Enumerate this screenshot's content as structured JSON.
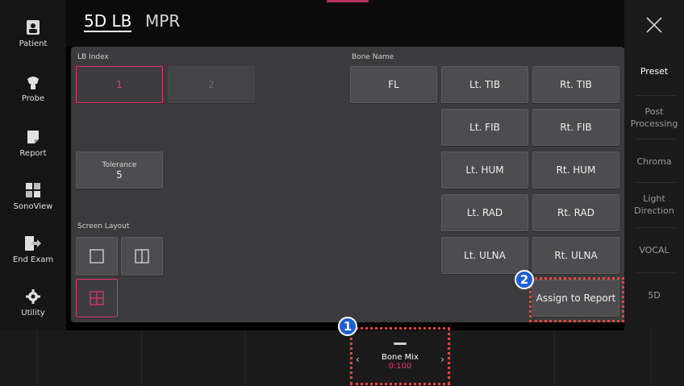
{
  "sidebar": {
    "items": [
      {
        "label": "Patient",
        "icon": "patient-icon"
      },
      {
        "label": "Probe",
        "icon": "probe-icon"
      },
      {
        "label": "Report",
        "icon": "report-icon"
      },
      {
        "label": "SonoView",
        "icon": "sonoview-icon"
      },
      {
        "label": "End Exam",
        "icon": "end-exam-icon"
      },
      {
        "label": "Utility",
        "icon": "gear-icon"
      }
    ]
  },
  "header": {
    "tabs": [
      {
        "label": "5D LB",
        "active": true
      },
      {
        "label": "MPR",
        "active": false
      }
    ]
  },
  "right_menu": {
    "items": [
      {
        "label": "Preset",
        "active": true
      },
      {
        "label": "Post Processing",
        "active": false
      },
      {
        "label": "Chroma",
        "active": false
      },
      {
        "label": "Light Direction",
        "active": false
      },
      {
        "label": "VOCAL",
        "active": false
      },
      {
        "label": "5D",
        "active": false
      }
    ]
  },
  "panel": {
    "lb_index_label": "LB Index",
    "lb_index_buttons": [
      "1",
      "2"
    ],
    "tolerance_label": "Tolerance",
    "tolerance_value": "5",
    "screen_layout_label": "Screen Layout",
    "bone_name_label": "Bone Name",
    "bone_buttons": {
      "fl": "FL",
      "lt_tib": "Lt. TIB",
      "rt_tib": "Rt. TIB",
      "lt_fib": "Lt. FIB",
      "rt_fib": "Rt. FIB",
      "lt_hum": "Lt. HUM",
      "rt_hum": "Rt. HUM",
      "lt_rad": "Lt. RAD",
      "rt_rad": "Rt. RAD",
      "lt_ulna": "Lt. ULNA",
      "rt_ulna": "Rt. ULNA"
    },
    "assign_label": "Assign to Report"
  },
  "bottom": {
    "bone_mix_label": "Bone Mix",
    "bone_mix_value": "0:100"
  },
  "badges": [
    "1",
    "2"
  ],
  "colors": {
    "accent_pink": "#e8356f",
    "highlight_red": "#e8473f",
    "badge_blue": "#1e5fd1"
  }
}
